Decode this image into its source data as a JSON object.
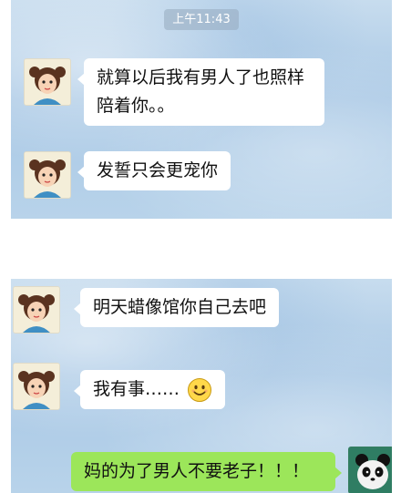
{
  "panel1": {
    "timestamp": "上午11:43",
    "messages": [
      {
        "text": "就算以后我有男人了也照样陪着你。。"
      },
      {
        "text": "发誓只会更宠你"
      }
    ]
  },
  "panel2": {
    "messages": [
      {
        "text": "明天蜡像馆你自己去吧"
      },
      {
        "text": "我有事……",
        "emoji": "smile-emoji"
      },
      {
        "text": "妈的为了男人不要老子！！！"
      }
    ]
  },
  "icons": {
    "friend_avatar": "girl-with-pigtails-avatar",
    "my_avatar": "panda-avatar"
  },
  "colors": {
    "background": "#b2cfe8",
    "incoming_bubble": "#ffffff",
    "outgoing_bubble": "#9ce65a"
  }
}
